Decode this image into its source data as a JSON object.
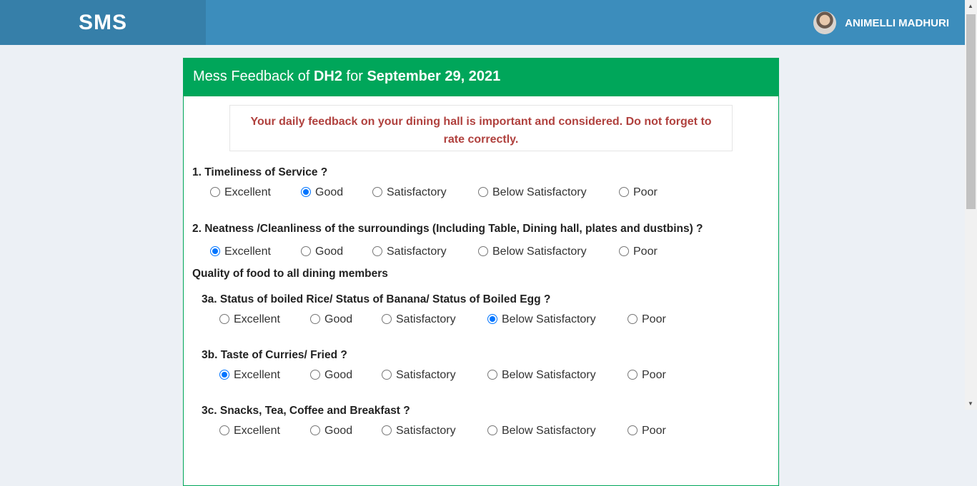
{
  "header": {
    "brand": "SMS",
    "user_name": "ANIMELLI MADHURI"
  },
  "card": {
    "title_prefix": "Mess Feedback of ",
    "hall": "DH2",
    "title_mid": " for ",
    "date": "September 29, 2021"
  },
  "alert": "Your daily feedback on your dining hall is important and considered. Do not forget to rate correctly.",
  "options": [
    "Excellent",
    "Good",
    "Satisfactory",
    "Below Satisfactory",
    "Poor"
  ],
  "section_heading": "Quality of food to all dining members",
  "questions": [
    {
      "label": "1. Timeliness of Service ?",
      "selected": 1
    },
    {
      "label": "2. Neatness /Cleanliness of the surroundings (Including Table, Dining hall, plates and dustbins) ?",
      "selected": 0
    },
    {
      "label": "3a. Status of boiled Rice/ Status of Banana/ Status of Boiled Egg ?",
      "selected": 3
    },
    {
      "label": "3b. Taste of Curries/ Fried ?",
      "selected": 0
    },
    {
      "label": "3c. Snacks, Tea, Coffee and Breakfast ?",
      "selected": -1
    }
  ]
}
